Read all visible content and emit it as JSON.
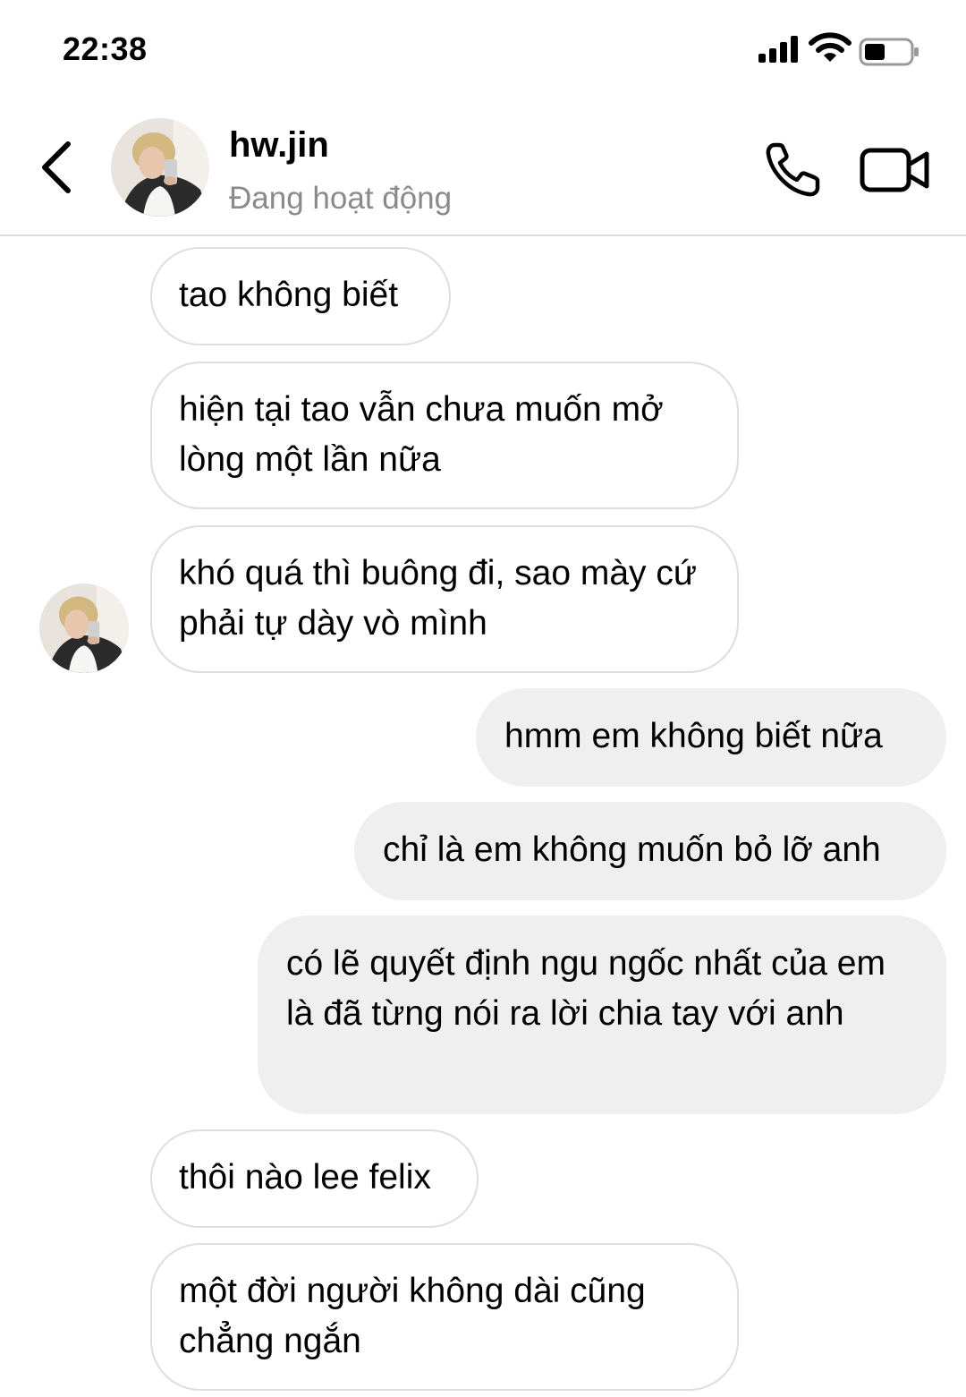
{
  "status_bar": {
    "time": "22:38"
  },
  "header": {
    "contact_name": "hw.jin",
    "contact_status": "Đang hoạt động"
  },
  "messages": [
    {
      "direction": "incoming",
      "text": "tao không biết"
    },
    {
      "direction": "incoming",
      "text": "hiện tại tao vẫn chưa muốn mở lòng một lần nữa"
    },
    {
      "direction": "incoming",
      "text": "khó quá thì buông đi, sao mày cứ phải tự dày vò mình"
    },
    {
      "direction": "outgoing",
      "text": "hmm em không biết nữa"
    },
    {
      "direction": "outgoing",
      "text": "chỉ là em không muốn bỏ lỡ anh"
    },
    {
      "direction": "outgoing",
      "text": "có lẽ quyết định ngu ngốc nhất của em là đã từng nói ra lời chia tay với anh"
    },
    {
      "direction": "incoming",
      "text": "thôi nào lee felix"
    },
    {
      "direction": "incoming",
      "text": "một đời người không dài cũng chẳng ngắn"
    }
  ]
}
